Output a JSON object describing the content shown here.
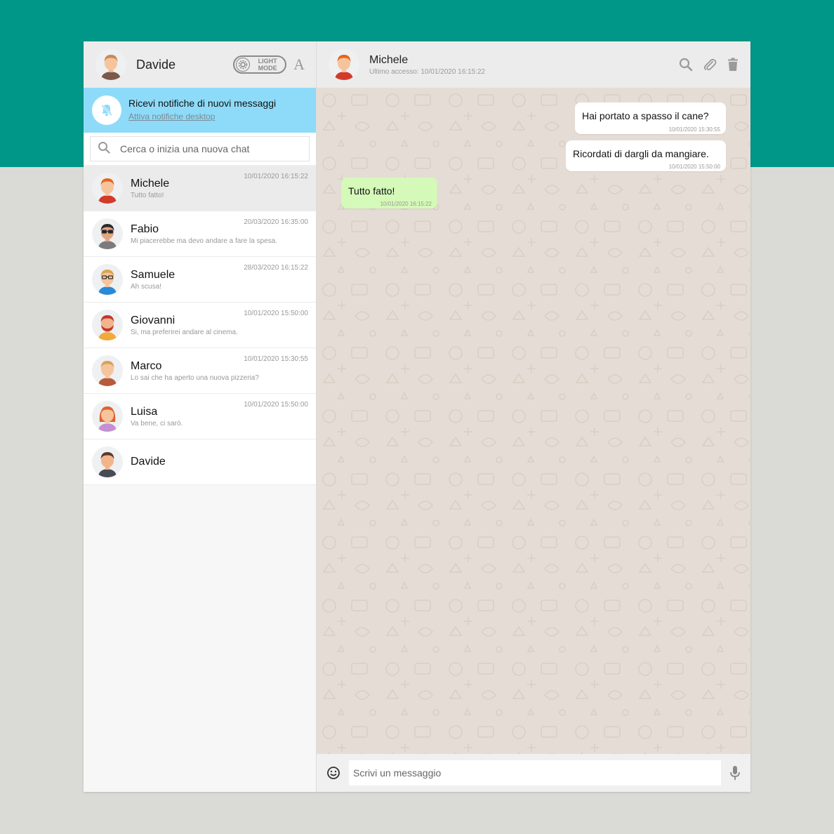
{
  "current_user": {
    "name": "Davide"
  },
  "theme_toggle": {
    "line1": "LIGHT",
    "line2": "MODE"
  },
  "font_button": "A",
  "notification": {
    "title": "Ricevi notifiche di nuovi messaggi",
    "link": "Attiva notifiche desktop"
  },
  "search": {
    "placeholder": "Cerca o inizia una nuova chat"
  },
  "contacts": [
    {
      "name": "Michele",
      "last_message": "Tutto fatto!",
      "time": "10/01/2020 16:15:22",
      "active": true
    },
    {
      "name": "Fabio",
      "last_message": "Mi piacerebbe ma devo andare a fare la spesa.",
      "time": "20/03/2020 16:35:00"
    },
    {
      "name": "Samuele",
      "last_message": "Ah scusa!",
      "time": "28/03/2020 16:15:22"
    },
    {
      "name": "Giovanni",
      "last_message": "Si, ma preferirei andare al cinema.",
      "time": "10/01/2020 15:50:00"
    },
    {
      "name": "Marco",
      "last_message": "Lo sai che ha aperto una nuova pizzeria?",
      "time": "10/01/2020 15:30:55"
    },
    {
      "name": "Luisa",
      "last_message": "Va bene, ci sarò.",
      "time": "10/01/2020 15:50:00"
    },
    {
      "name": "Davide",
      "last_message": "",
      "time": ""
    }
  ],
  "chat": {
    "name": "Michele",
    "last_seen": "Ultimo accesso: 10/01/2020 16:15:22",
    "messages": [
      {
        "text": "Hai portato a spasso il cane?",
        "time": "10/01/2020 15:30:55",
        "direction": "sent"
      },
      {
        "text": "Ricordati di dargli da mangiare.",
        "time": "10/01/2020 15:50:00",
        "direction": "sent"
      },
      {
        "text": "Tutto fatto!",
        "time": "10/01/2020 16:15:22",
        "direction": "received"
      }
    ]
  },
  "composer": {
    "placeholder": "Scrivi un messaggio"
  },
  "colors": {
    "brand": "#009688",
    "notification_bg": "#8edbf9",
    "sent_bubble": "#ffffff",
    "received_bubble": "#d5f9b8",
    "chat_bg": "#e5ddd5"
  },
  "icons": {
    "header": [
      "search-icon",
      "paperclip-icon",
      "trash-icon"
    ],
    "composer": [
      "emoji-icon",
      "microphone-icon"
    ],
    "notification": "bell-off-icon"
  }
}
